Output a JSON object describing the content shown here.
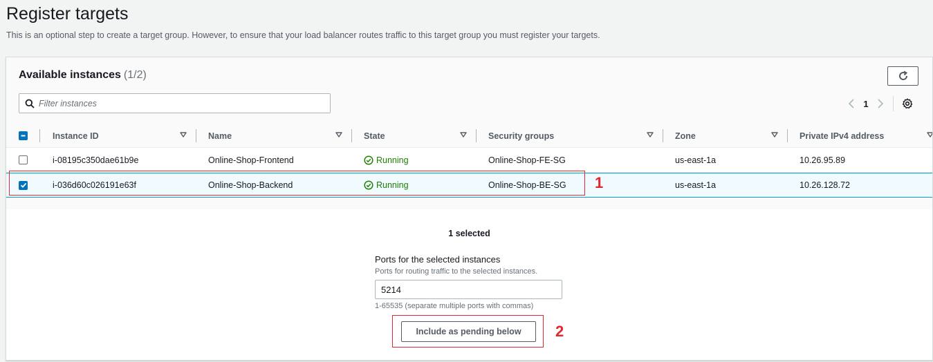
{
  "page": {
    "title": "Register targets",
    "description": "This is an optional step to create a target group. However, to ensure that your load balancer routes traffic to this target group you must register your targets."
  },
  "instances": {
    "title": "Available instances",
    "count": "(1/2)",
    "filter_placeholder": "Filter instances",
    "page_number": "1",
    "columns": [
      "Instance ID",
      "Name",
      "State",
      "Security groups",
      "Zone",
      "Private IPv4 address"
    ],
    "rows": [
      {
        "checked": false,
        "instance_id": "i-08195c350dae61b9e",
        "name": "Online-Shop-Frontend",
        "state": "Running",
        "security_group": "Online-Shop-FE-SG",
        "zone": "us-east-1a",
        "ipv4": "10.26.95.89"
      },
      {
        "checked": true,
        "instance_id": "i-036d60c026191e63f",
        "name": "Online-Shop-Backend",
        "state": "Running",
        "security_group": "Online-Shop-BE-SG",
        "zone": "us-east-1a",
        "ipv4": "10.26.128.72"
      }
    ]
  },
  "selection": {
    "count_label": "1 selected",
    "ports_label": "Ports for the selected instances",
    "ports_description": "Ports for routing traffic to the selected instances.",
    "ports_value": "5214",
    "ports_hint": "1-65535 (separate multiple ports with commas)",
    "include_button": "Include as pending below"
  },
  "annotations": [
    "1",
    "2"
  ],
  "colors": {
    "accent": "#0073bb",
    "running": "#1d8102",
    "annotation": "#e0292f"
  }
}
